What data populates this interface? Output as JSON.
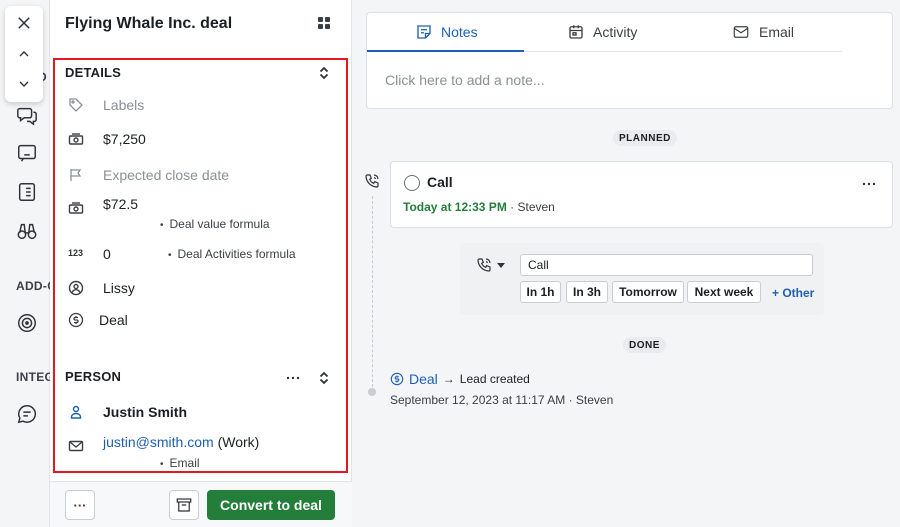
{
  "rail": {
    "labels": [
      "ADD-O",
      "INTEG"
    ],
    "partial": [
      "D"
    ]
  },
  "panel": {
    "title": "Flying Whale Inc. deal",
    "details": {
      "heading": "DETAILS",
      "labels_placeholder": "Labels",
      "value": "$7,250",
      "close_date_placeholder": "Expected close date",
      "formula_value": "$72.5",
      "formula_caption": "Deal value formula",
      "activities_count": "0",
      "activities_caption": "Deal Activities formula",
      "owner": "Lissy",
      "type": "Deal"
    },
    "person": {
      "heading": "PERSON",
      "name": "Justin Smith",
      "email": "justin@smith.com",
      "email_type": "(Work)",
      "email_caption": "Email"
    },
    "footer": {
      "more_label": "···",
      "convert_label": "Convert to deal"
    }
  },
  "timeline": {
    "tabs": [
      {
        "label": "Notes",
        "icon": "note-icon",
        "active": true
      },
      {
        "label": "Activity",
        "icon": "calendar-icon",
        "active": false
      },
      {
        "label": "Email",
        "icon": "mail-icon",
        "active": false
      }
    ],
    "note_placeholder": "Click here to add a note...",
    "planned_label": "PLANNED",
    "activity": {
      "title": "Call",
      "when": "Today at 12:33 PM",
      "sep": "·",
      "assignee": "Steven"
    },
    "schedule": {
      "input_value": "Call",
      "chips": [
        "In 1h",
        "In 3h",
        "Tomorrow",
        "Next week"
      ],
      "other": "+ Other"
    },
    "done_label": "DONE",
    "done": {
      "entity": "Deal",
      "arrow": "→",
      "event": "Lead created",
      "date": "September 12, 2023 at 11:17 AM",
      "sep": "·",
      "user": "Steven"
    }
  },
  "colors": {
    "accent": "#1d5fb4",
    "primary_button": "#237e3a",
    "highlight": "#e4181e"
  }
}
